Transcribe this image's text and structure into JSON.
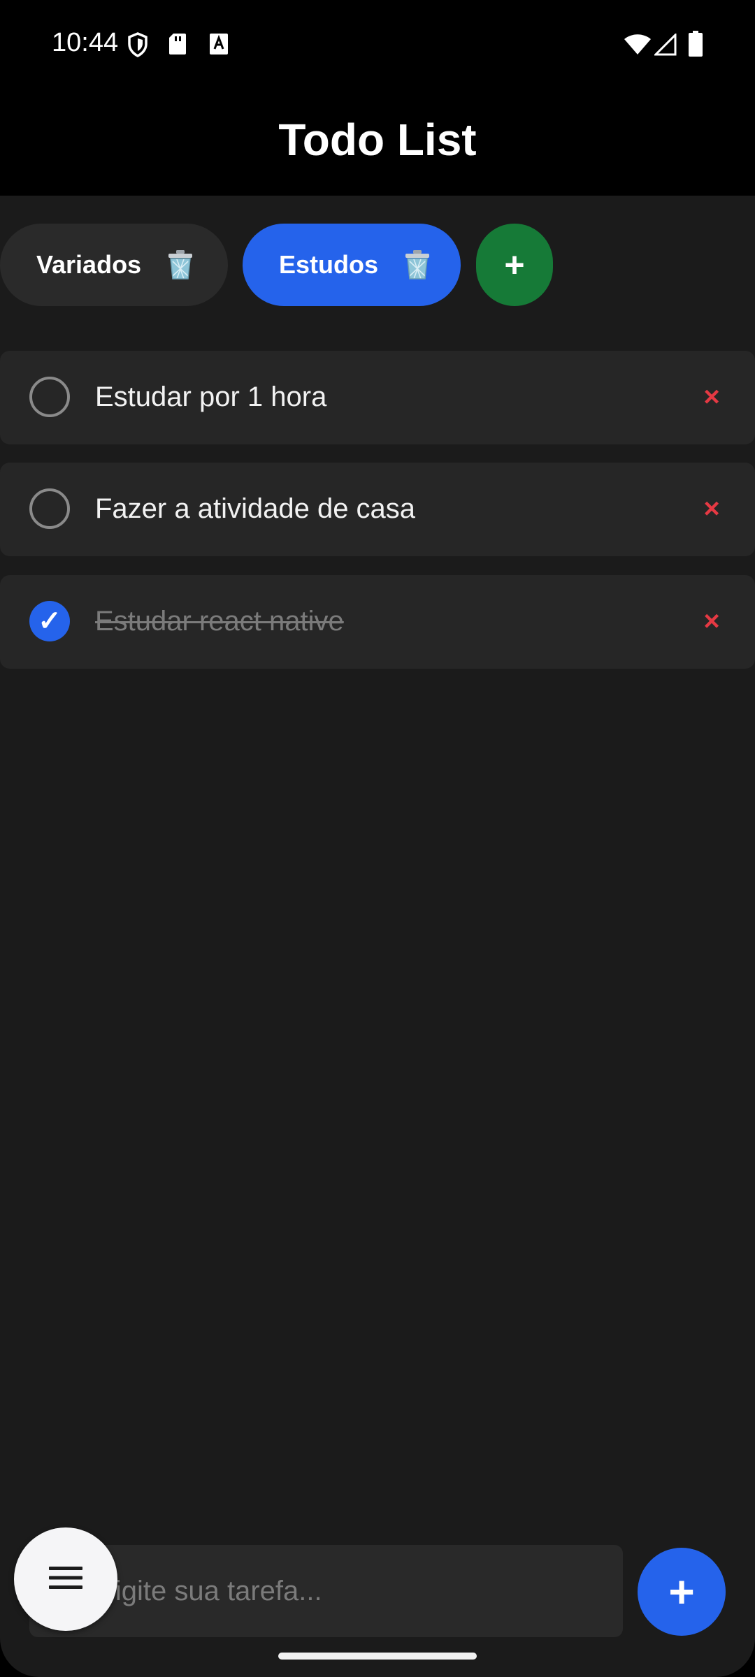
{
  "status_bar": {
    "time": "10:44",
    "left_icons": [
      "shield-icon",
      "sd-card-icon",
      "text-a-icon"
    ],
    "right_icons": [
      "wifi-icon",
      "signal-icon",
      "battery-icon"
    ]
  },
  "header": {
    "title": "Todo List"
  },
  "categories": [
    {
      "label": "Variados",
      "selected": false,
      "delete_icon": "trash-icon"
    },
    {
      "label": "Estudos",
      "selected": true,
      "delete_icon": "trash-icon"
    }
  ],
  "add_category": {
    "label": "+"
  },
  "tasks": [
    {
      "text": "Estudar por 1 hora",
      "done": false,
      "delete_label": "×"
    },
    {
      "text": "Fazer a atividade de casa",
      "done": false,
      "delete_label": "×"
    },
    {
      "text": "Estudar react native",
      "done": true,
      "check_label": "✓",
      "delete_label": "×"
    }
  ],
  "input": {
    "placeholder": "Digite sua tarefa...",
    "value": ""
  },
  "add_task": {
    "label": "+"
  },
  "menu_fab": {
    "icon": "menu-icon"
  },
  "colors": {
    "accent": "#2563eb",
    "add_category": "#167a37",
    "delete": "#e53943",
    "background": "#1b1b1b",
    "card": "#262626"
  }
}
